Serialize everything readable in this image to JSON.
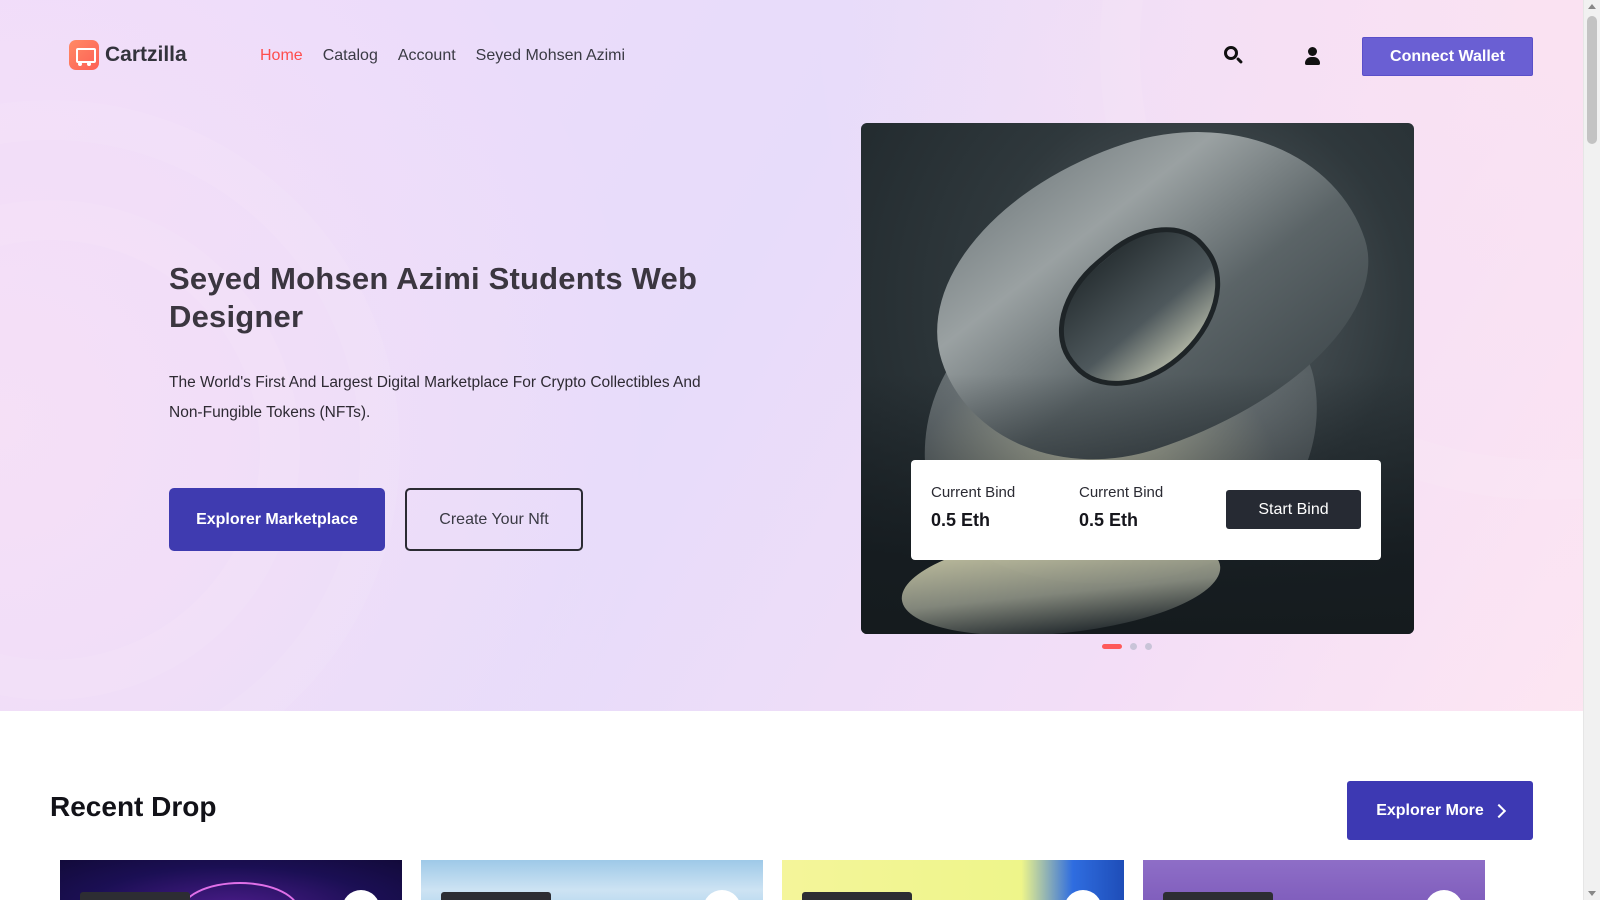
{
  "brand": {
    "name": "Cartzilla",
    "icon": "cart-logo-icon"
  },
  "nav": {
    "items": [
      {
        "label": "Home",
        "active": true
      },
      {
        "label": "Catalog",
        "active": false
      },
      {
        "label": "Account",
        "active": false
      },
      {
        "label": "Seyed Mohsen Azimi",
        "active": false
      }
    ]
  },
  "header": {
    "search_icon": "search-icon",
    "user_icon": "user-icon",
    "connect_label": "Connect Wallet"
  },
  "hero": {
    "title": "Seyed Mohsen Azimi Students Web Designer",
    "description": "The World's First And Largest Digital Marketplace For Crypto Collectibles And Non-Fungible Tokens (NFTs).",
    "primary_label": "Explorer Marketplace",
    "secondary_label": "Create Your Nft",
    "bid": {
      "col1_label": "Current Bind",
      "col1_value": "0.5 Eth",
      "col2_label": "Current Bind",
      "col2_value": "0.5 Eth",
      "button_label": "Start Bind"
    },
    "carousel": {
      "slides": 3,
      "active": 1
    }
  },
  "recent": {
    "title": "Recent Drop",
    "more_label": "Explorer More",
    "more_icon": "chevron-right-icon",
    "cards": [
      {
        "theme": "purple-neon"
      },
      {
        "theme": "sky"
      },
      {
        "theme": "yellow-blue"
      },
      {
        "theme": "violet"
      }
    ]
  },
  "colors": {
    "accent": "#3f3bb0",
    "connect": "#6a5fd3",
    "active_nav": "#fe4d4d",
    "dark_button": "#262a33"
  }
}
